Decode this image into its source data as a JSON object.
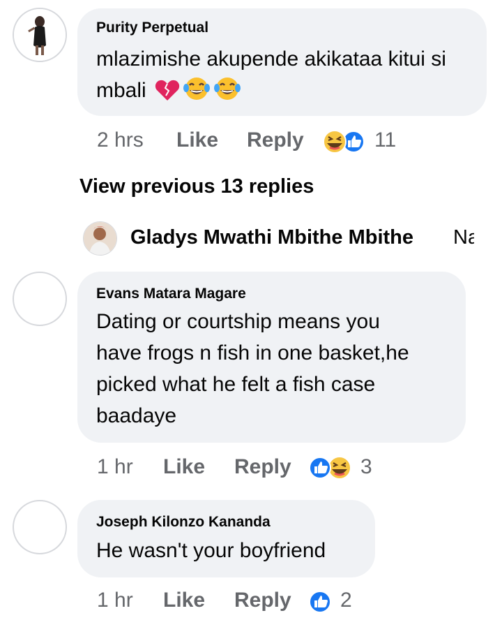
{
  "comments": [
    {
      "author": "Purity Perpetual",
      "text": "mlazimishe akupende akikataa kitui si mbali",
      "inline_emojis": [
        "broken-heart",
        "tears-of-joy",
        "tears-of-joy"
      ],
      "time": "2 hrs",
      "like_label": "Like",
      "reply_label": "Reply",
      "reactions": [
        "haha",
        "like"
      ],
      "reaction_count": "11"
    }
  ],
  "view_previous": "View previous 13 replies",
  "reply_preview": {
    "author": "Gladys Mwathi Mbithe Mbithe",
    "text": "Na"
  },
  "thread": [
    {
      "author": "Evans Matara Magare",
      "lines": [
        "Dating or courtship means you",
        "have frogs n fish in one basket,he",
        "picked what he felt a fish case",
        "baadaye"
      ],
      "time": "1 hr",
      "like_label": "Like",
      "reply_label": "Reply",
      "reactions": [
        "like",
        "haha"
      ],
      "reaction_count": "3"
    },
    {
      "author": "Joseph Kilonzo Kananda",
      "lines": [
        "He wasn't your boyfriend"
      ],
      "time": "1 hr",
      "like_label": "Like",
      "reply_label": "Reply",
      "reactions": [
        "like"
      ],
      "reaction_count": "2"
    }
  ],
  "colors": {
    "bubble": "#f0f2f5",
    "meta": "#65676b",
    "like_blue": "#1877f2",
    "haha_yellow": "#f7c643"
  }
}
